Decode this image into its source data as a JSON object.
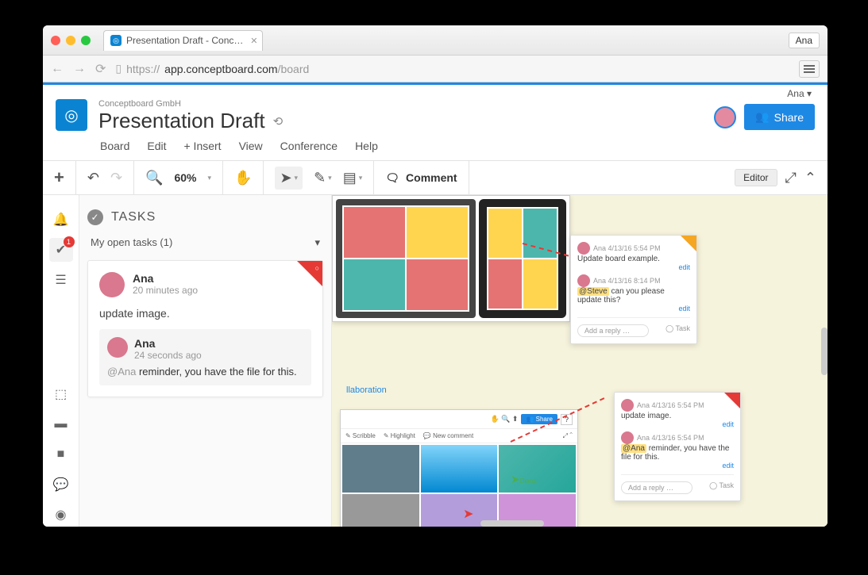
{
  "browser": {
    "tab_title": "Presentation Draft - Conc…",
    "url_host": "app.conceptboard.com",
    "url_path": "/board",
    "url_prefix": "https://",
    "user_badge": "Ana"
  },
  "header": {
    "user_label": "Ana ▾",
    "org": "Conceptboard GmbH",
    "title": "Presentation Draft",
    "share_label": "Share"
  },
  "menus": {
    "board": "Board",
    "edit": "Edit",
    "insert": "+ Insert",
    "view": "View",
    "conference": "Conference",
    "help": "Help"
  },
  "toolbar": {
    "zoom": "60%",
    "comment": "Comment",
    "editor_badge": "Editor"
  },
  "panel": {
    "title": "TASKS",
    "filter": "My open tasks (1)",
    "badge_count": "1"
  },
  "task": {
    "author": "Ana",
    "time": "20 minutes ago",
    "body": "update image.",
    "reply_author": "Ana",
    "reply_time": "24 seconds ago",
    "reply_mention": "@Ana",
    "reply_body": " reminder, you have the file for this."
  },
  "canvas": {
    "collab_label": "llaboration",
    "card1": {
      "meta1": "Ana 4/13/16 5:54 PM",
      "text1": "Update board example.",
      "meta2": "Ana 4/13/16 8:14 PM",
      "mention": "@Steve",
      "text2": " can you please update this?",
      "edit": "edit",
      "reply_ph": "Add a reply …",
      "task": "Task"
    },
    "card2": {
      "meta1": "Ana 4/13/16 5:54 PM",
      "text1": "update image.",
      "meta2": "Ana 4/13/16 5:54 PM",
      "mention": "@Ana",
      "text2": " reminder, you have the file for this.",
      "edit": "edit",
      "reply_ph": "Add a reply …",
      "task": "Task"
    },
    "inner": {
      "share": "Share",
      "scribble": "✎ Scribble",
      "highlight": "✎ Highlight",
      "newcomment": "💬 New comment"
    }
  }
}
